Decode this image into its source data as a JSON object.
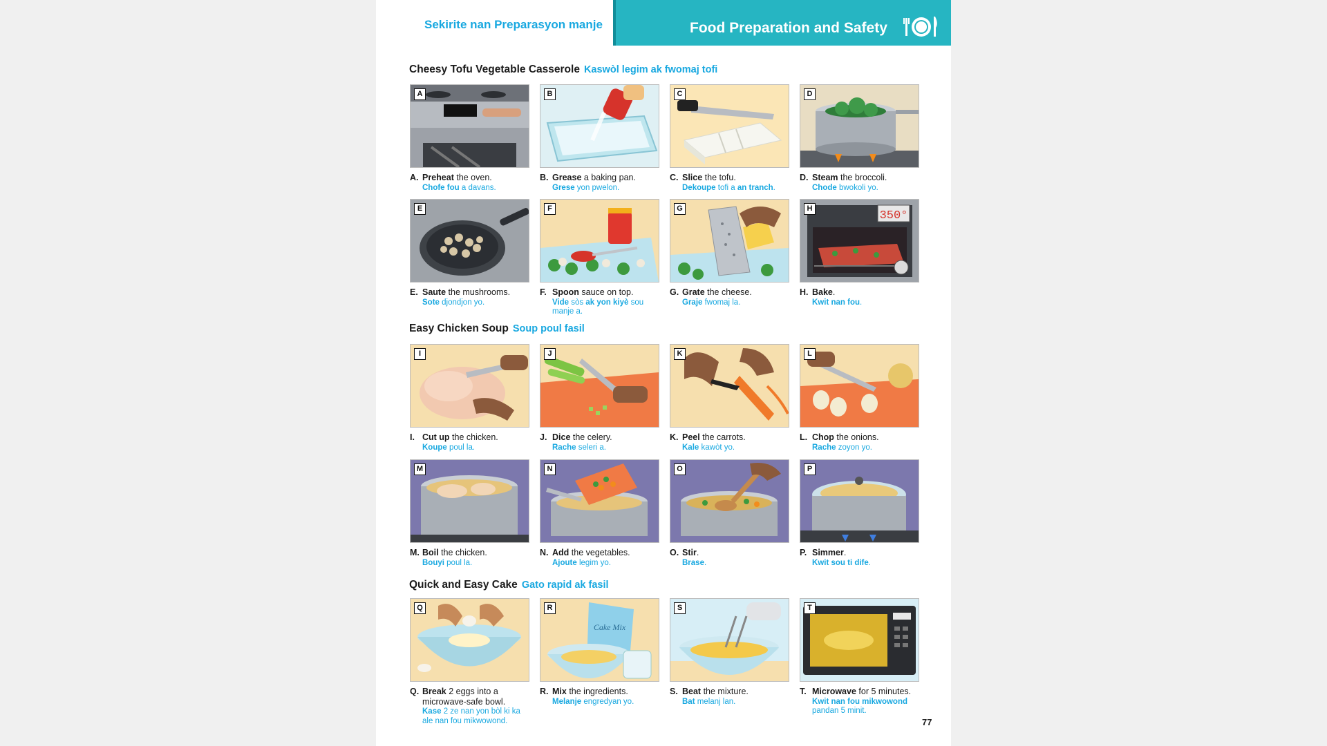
{
  "header": {
    "left_title": "Sekirite nan Preparasyon manje",
    "right_title": "Food Preparation and Safety",
    "icon": "plate-fork-knife-icon"
  },
  "sections": [
    {
      "title": "Cheesy Tofu Vegetable Casserole",
      "translation": "Kaswòl legim ak fwomaj tofi"
    },
    {
      "title": "Easy Chicken Soup",
      "translation": "Soup poul fasil"
    },
    {
      "title": "Quick and Easy Cake",
      "translation": "Gato rapid ak fasil"
    }
  ],
  "steps": [
    {
      "letter": "A",
      "label": "A.",
      "verb": "Preheat",
      "rest": " the oven.",
      "ht_a": "Chofe fou",
      "ht_b": " a davans.",
      "ht_c": "",
      "ht_d": "",
      "icon": "oven-icon"
    },
    {
      "letter": "B",
      "label": "B.",
      "verb": "Grease",
      "rest": " a baking pan.",
      "ht_a": "Grese",
      "ht_b": " yon pwelon.",
      "ht_c": "",
      "ht_d": "",
      "icon": "baking-pan-icon"
    },
    {
      "letter": "C",
      "label": "C.",
      "verb": "Slice",
      "rest": " the tofu.",
      "ht_a": "Dekoupe",
      "ht_b": " tofi a ",
      "ht_c": "an tranch",
      "ht_d": ".",
      "icon": "knife-tofu-icon"
    },
    {
      "letter": "D",
      "label": "D.",
      "verb": "Steam",
      "rest": " the broccoli.",
      "ht_a": "Chode",
      "ht_b": " bwokoli yo.",
      "ht_c": "",
      "ht_d": "",
      "icon": "steamer-icon"
    },
    {
      "letter": "E",
      "label": "E.",
      "verb": "Saute",
      "rest": " the mushrooms.",
      "ht_a": "Sote",
      "ht_b": " djondjon yo.",
      "ht_c": "",
      "ht_d": "",
      "icon": "frying-pan-icon"
    },
    {
      "letter": "F",
      "label": "F.",
      "verb": "Spoon",
      "rest": " sauce on top.",
      "ht_a": "Vide",
      "ht_b": " sòs ",
      "ht_c": "ak yon kiyè",
      "ht_d": " sou manje a.",
      "icon": "sauce-jar-icon"
    },
    {
      "letter": "G",
      "label": "G.",
      "verb": "Grate",
      "rest": " the cheese.",
      "ht_a": "Graje",
      "ht_b": " fwomaj la.",
      "ht_c": "",
      "ht_d": "",
      "icon": "grater-icon"
    },
    {
      "letter": "H",
      "label": "H.",
      "verb": "Bake",
      "rest": ".",
      "ht_a": "Kwit nan fou",
      "ht_b": ".",
      "ht_c": "",
      "ht_d": "",
      "icon": "oven-display-icon",
      "display": "350°"
    },
    {
      "letter": "I",
      "label": "I.",
      "verb": "Cut up",
      "rest": " the chicken.",
      "ht_a": "Koupe",
      "ht_b": " poul la.",
      "ht_c": "",
      "ht_d": "",
      "icon": "chicken-icon"
    },
    {
      "letter": "J",
      "label": "J.",
      "verb": "Dice",
      "rest": " the celery.",
      "ht_a": "Rache",
      "ht_b": " seleri a.",
      "ht_c": "",
      "ht_d": "",
      "icon": "celery-icon"
    },
    {
      "letter": "K",
      "label": "K.",
      "verb": "Peel",
      "rest": " the carrots.",
      "ht_a": "Kale",
      "ht_b": " kawòt yo.",
      "ht_c": "",
      "ht_d": "",
      "icon": "peeler-carrot-icon"
    },
    {
      "letter": "L",
      "label": "L.",
      "verb": "Chop",
      "rest": " the onions.",
      "ht_a": "Rache",
      "ht_b": " zoyon yo.",
      "ht_c": "",
      "ht_d": "",
      "icon": "onion-icon"
    },
    {
      "letter": "M",
      "label": "M.",
      "verb": "Boil",
      "rest": " the chicken.",
      "ht_a": "Bouyi",
      "ht_b": " poul la.",
      "ht_c": "",
      "ht_d": "",
      "icon": "boiling-pot-icon"
    },
    {
      "letter": "N",
      "label": "N.",
      "verb": "Add",
      "rest": " the vegetables.",
      "ht_a": "Ajoute",
      "ht_b": " legim yo.",
      "ht_c": "",
      "ht_d": "",
      "icon": "cutting-board-pot-icon"
    },
    {
      "letter": "O",
      "label": "O.",
      "verb": "Stir",
      "rest": ".",
      "ht_a": "Brase",
      "ht_b": ".",
      "ht_c": "",
      "ht_d": "",
      "icon": "wooden-spoon-pot-icon"
    },
    {
      "letter": "P",
      "label": "P.",
      "verb": "Simmer",
      "rest": ".",
      "ht_a": "Kwit sou ti dife",
      "ht_b": ".",
      "ht_c": "",
      "ht_d": "",
      "icon": "covered-pot-icon"
    },
    {
      "letter": "Q",
      "label": "Q.",
      "verb": "Break",
      "rest": " 2 eggs into a microwave-safe bowl.",
      "ht_a": "Kase",
      "ht_b": " 2 ze nan yon bòl ki ka ale nan fou mikwowond.",
      "ht_c": "",
      "ht_d": "",
      "icon": "egg-bowl-icon"
    },
    {
      "letter": "R",
      "label": "R.",
      "verb": "Mix",
      "rest": " the ingredients.",
      "ht_a": "Melanje",
      "ht_b": " engredyan yo.",
      "ht_c": "",
      "ht_d": "",
      "icon": "cake-mix-icon",
      "box": "Cake Mix"
    },
    {
      "letter": "S",
      "label": "S.",
      "verb": "Beat",
      "rest": " the mixture.",
      "ht_a": "Bat",
      "ht_b": " melanj lan.",
      "ht_c": "",
      "ht_d": "",
      "icon": "mixer-icon"
    },
    {
      "letter": "T",
      "label": "T.",
      "verb": "Microwave",
      "rest": " for 5 minutes.",
      "ht_a": "Kwit nan fou mikwowond",
      "ht_b": " pandan 5 minit.",
      "ht_c": "",
      "ht_d": "",
      "icon": "microwave-icon"
    }
  ],
  "page_number": "77",
  "colors": {
    "accent": "#18a8e0",
    "header_bar": "#26b5c2",
    "header_edge": "#118d99"
  }
}
